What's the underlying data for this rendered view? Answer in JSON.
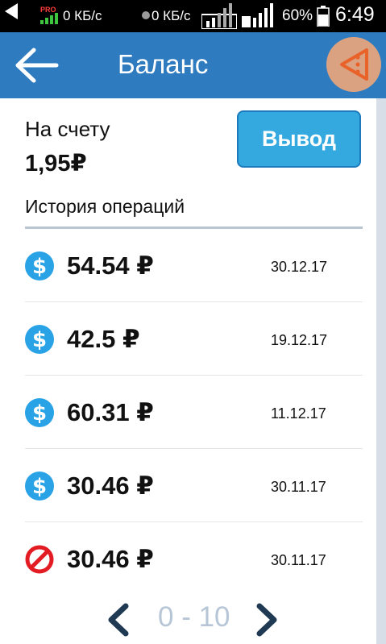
{
  "status_bar": {
    "pro_badge": "PRO",
    "speed_1": "0 КБ/с",
    "speed_2": "0 КБ/с",
    "network_type": "H",
    "sim_slot": "2",
    "battery": "60%",
    "time": "6:49"
  },
  "header": {
    "title": "Баланс",
    "back_icon": "arrow-left-icon",
    "menu_icon": "share-menu-icon"
  },
  "balance": {
    "label": "На счету",
    "amount": "1,95₽",
    "withdraw_label": "Вывод"
  },
  "history": {
    "title": "История операций",
    "operations": [
      {
        "amount": "54.54 ₽",
        "date": "30.12.17",
        "icon": "dollar-icon",
        "status": "success"
      },
      {
        "amount": "42.5 ₽",
        "date": "19.12.17",
        "icon": "dollar-icon",
        "status": "success"
      },
      {
        "amount": "60.31 ₽",
        "date": "11.12.17",
        "icon": "dollar-icon",
        "status": "success"
      },
      {
        "amount": "30.46 ₽",
        "date": "30.11.17",
        "icon": "dollar-icon",
        "status": "success"
      },
      {
        "amount": "30.46 ₽",
        "date": "30.11.17",
        "icon": "blocked-icon",
        "status": "rejected"
      }
    ]
  },
  "pagination": {
    "range": "0 - 10",
    "prev_icon": "chevron-left-icon",
    "next_icon": "chevron-right-icon"
  },
  "colors": {
    "app_bar": "#2f7bbf",
    "button": "#33a9e0",
    "icon_success": "#2aa3e6",
    "icon_rejected": "#e31b23",
    "fab": "#dba282",
    "fab_icon": "#e8622a"
  }
}
